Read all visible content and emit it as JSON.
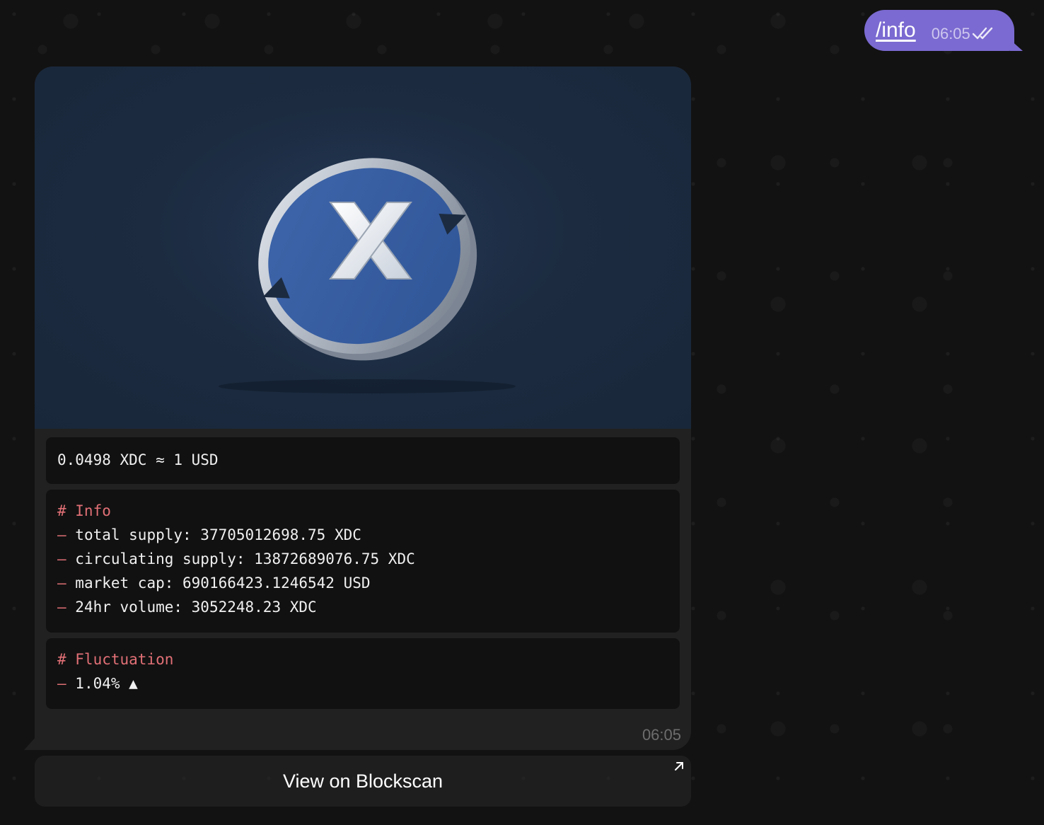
{
  "outgoing": {
    "command": "/info",
    "time": "06:05",
    "status_icon": "double-check-icon",
    "bubble_color": "#7b6ad1"
  },
  "incoming": {
    "image": {
      "icon": "xdc-coin-logo",
      "letter": "X",
      "background": "#1c2b40"
    },
    "price_line": "0.0498 XDC ≈ 1 USD",
    "info": {
      "heading": "# Info",
      "lines": [
        {
          "dash": "–",
          "text": " total supply: 37705012698.75 XDC"
        },
        {
          "dash": "–",
          "text": " circulating supply: 13872689076.75 XDC"
        },
        {
          "dash": "–",
          "text": " market cap: 690166423.1246542 USD"
        },
        {
          "dash": "–",
          "text": " 24hr volume: 3052248.23 XDC"
        }
      ]
    },
    "fluctuation": {
      "heading": "# Fluctuation",
      "lines": [
        {
          "dash": "–",
          "text": " 1.04% ▲"
        }
      ]
    },
    "time": "06:05",
    "accent_color": "#e17076"
  },
  "inline_button": {
    "label": "View on Blockscan",
    "icon": "open-link-arrow-icon"
  }
}
